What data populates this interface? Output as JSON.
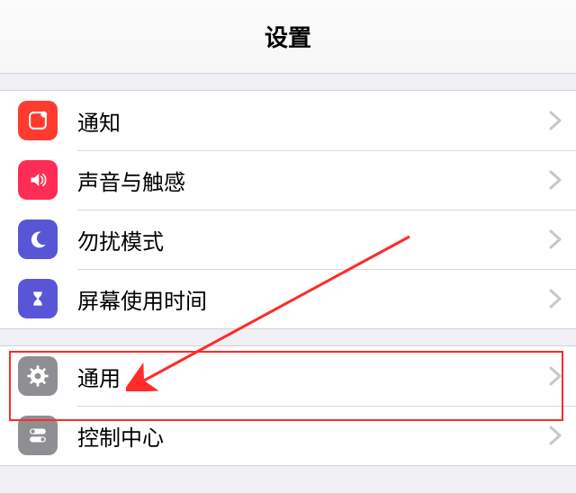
{
  "header": {
    "title": "设置"
  },
  "groups": [
    {
      "rows": [
        {
          "id": "notifications",
          "label": "通知",
          "icon": "notifications-icon",
          "bg": "#ff3b30"
        },
        {
          "id": "sounds",
          "label": "声音与触感",
          "icon": "sounds-icon",
          "bg": "#ff2d55"
        },
        {
          "id": "do-not-disturb",
          "label": "勿扰模式",
          "icon": "moon-icon",
          "bg": "#5856d6"
        },
        {
          "id": "screen-time",
          "label": "屏幕使用时间",
          "icon": "hourglass-icon",
          "bg": "#5856d6"
        }
      ]
    },
    {
      "rows": [
        {
          "id": "general",
          "label": "通用",
          "icon": "gear-icon",
          "bg": "#8e8e93",
          "highlighted": true
        },
        {
          "id": "control-center",
          "label": "控制中心",
          "icon": "toggles-icon",
          "bg": "#8e8e93"
        }
      ]
    }
  ],
  "annotation": {
    "target": "general"
  }
}
